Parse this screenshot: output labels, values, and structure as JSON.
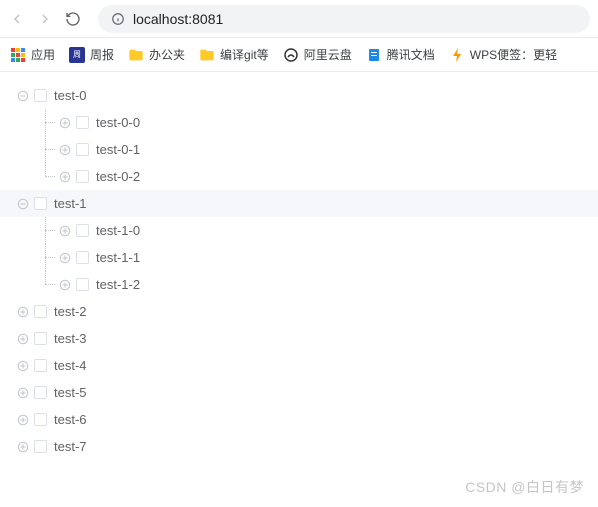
{
  "browser": {
    "url": "localhost:8081"
  },
  "bookmarks": {
    "apps": "应用",
    "items": [
      {
        "label": "周报",
        "iconType": "zhou"
      },
      {
        "label": "办公夹",
        "iconType": "folder"
      },
      {
        "label": "编译git等",
        "iconType": "folder"
      },
      {
        "label": "阿里云盘",
        "iconType": "ali"
      },
      {
        "label": "腾讯文档",
        "iconType": "tx"
      },
      {
        "label": "WPS便签：更轻",
        "iconType": "wps"
      }
    ]
  },
  "tree": [
    {
      "label": "test-0",
      "expanded": true,
      "highlighted": false,
      "children": [
        {
          "label": "test-0-0",
          "expanded": false
        },
        {
          "label": "test-0-1",
          "expanded": false
        },
        {
          "label": "test-0-2",
          "expanded": false
        }
      ]
    },
    {
      "label": "test-1",
      "expanded": true,
      "highlighted": true,
      "children": [
        {
          "label": "test-1-0",
          "expanded": false
        },
        {
          "label": "test-1-1",
          "expanded": false
        },
        {
          "label": "test-1-2",
          "expanded": false
        }
      ]
    },
    {
      "label": "test-2",
      "expanded": false
    },
    {
      "label": "test-3",
      "expanded": false
    },
    {
      "label": "test-4",
      "expanded": false
    },
    {
      "label": "test-5",
      "expanded": false
    },
    {
      "label": "test-6",
      "expanded": false
    },
    {
      "label": "test-7",
      "expanded": false
    }
  ],
  "watermark": "CSDN @白日有梦"
}
